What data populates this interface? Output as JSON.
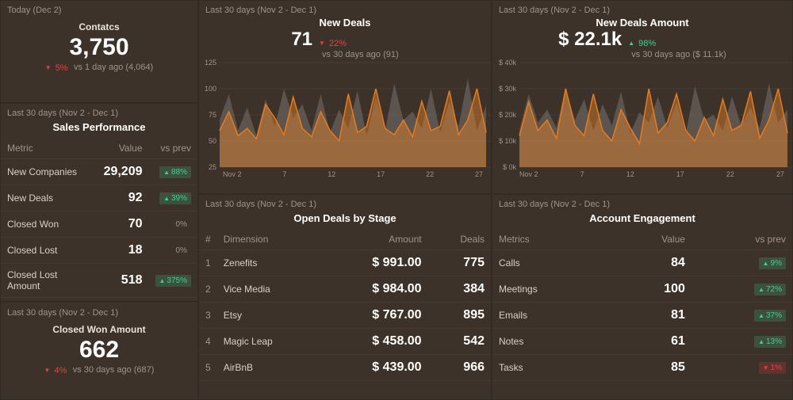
{
  "periods": {
    "today": "Today (Dec 2)",
    "last30": "Last 30 days (Nov 2 - Dec 1)"
  },
  "contacts": {
    "title": "Contatcs",
    "value": "3,750",
    "delta": "5%",
    "delta_dir": "down",
    "context": "vs 1 day ago (4,064)"
  },
  "sales_performance": {
    "title": "Sales Performance",
    "cols": [
      "Metric",
      "Value",
      "vs prev"
    ],
    "rows": [
      {
        "metric": "New Companies",
        "value": "29,209",
        "delta": "88%",
        "dir": "up"
      },
      {
        "metric": "New Deals",
        "value": "92",
        "delta": "39%",
        "dir": "up"
      },
      {
        "metric": "Closed Won",
        "value": "70",
        "delta": "0%",
        "dir": "neutral"
      },
      {
        "metric": "Closed Lost",
        "value": "18",
        "delta": "0%",
        "dir": "neutral"
      },
      {
        "metric": "Closed Lost Amount",
        "value": "518",
        "delta": "375%",
        "dir": "up"
      }
    ]
  },
  "closed_won": {
    "title": "Closed Won Amount",
    "value": "662",
    "delta": "4%",
    "delta_dir": "down",
    "context": "vs 30 days ago (687)"
  },
  "new_deals": {
    "title": "New Deals",
    "value": "71",
    "delta": "22%",
    "delta_dir": "down",
    "context": "vs 30 days ago (91)"
  },
  "new_deals_amount": {
    "title": "New Deals Amount",
    "value": "$ 22.1k",
    "delta": "98%",
    "delta_dir": "up",
    "context": "vs 30 days ago ($ 11.1k)"
  },
  "open_deals": {
    "title": "Open Deals by Stage",
    "cols": [
      "#",
      "Dimension",
      "Amount",
      "Deals"
    ],
    "rows": [
      {
        "n": "1",
        "dim": "Zenefits",
        "amount": "$ 991.00",
        "deals": "775"
      },
      {
        "n": "2",
        "dim": "Vice Media",
        "amount": "$ 984.00",
        "deals": "384"
      },
      {
        "n": "3",
        "dim": "Etsy",
        "amount": "$ 767.00",
        "deals": "895"
      },
      {
        "n": "4",
        "dim": "Magic Leap",
        "amount": "$ 458.00",
        "deals": "542"
      },
      {
        "n": "5",
        "dim": "AirBnB",
        "amount": "$ 439.00",
        "deals": "966"
      }
    ]
  },
  "engagement": {
    "title": "Account Engagement",
    "cols": [
      "Metrics",
      "Value",
      "vs prev"
    ],
    "rows": [
      {
        "metric": "Calls",
        "value": "84",
        "delta": "9%",
        "dir": "up"
      },
      {
        "metric": "Meetings",
        "value": "100",
        "delta": "72%",
        "dir": "up"
      },
      {
        "metric": "Emails",
        "value": "81",
        "delta": "37%",
        "dir": "up"
      },
      {
        "metric": "Notes",
        "value": "61",
        "delta": "13%",
        "dir": "up"
      },
      {
        "metric": "Tasks",
        "value": "85",
        "delta": "1%",
        "dir": "down"
      }
    ]
  },
  "chart_data": [
    {
      "type": "area",
      "title": "New Deals",
      "ylim": [
        25,
        125
      ],
      "yticks": [
        25,
        50,
        75,
        100,
        125
      ],
      "xlabels": [
        "Nov 2",
        "7",
        "12",
        "17",
        "22",
        "27"
      ],
      "series": [
        {
          "name": "previous",
          "values": [
            70,
            95,
            60,
            82,
            55,
            90,
            64,
            100,
            72,
            85,
            60,
            95,
            58,
            80,
            62,
            98,
            55,
            92,
            60,
            105,
            70,
            78,
            62,
            100,
            58,
            88,
            64,
            110,
            60,
            84
          ]
        },
        {
          "name": "current",
          "values": [
            60,
            78,
            55,
            62,
            52,
            85,
            72,
            56,
            92,
            62,
            54,
            78,
            60,
            50,
            95,
            58,
            64,
            100,
            62,
            56,
            70,
            54,
            88,
            60,
            64,
            98,
            56,
            70,
            100,
            58
          ]
        }
      ]
    },
    {
      "type": "area",
      "title": "New Deals Amount",
      "ylim": [
        0,
        40000
      ],
      "yticks": [
        "$ 0k",
        "$ 10k",
        "$ 20k",
        "$ 30k",
        "$ 40k"
      ],
      "xlabels": [
        "Nov 2",
        "7",
        "12",
        "17",
        "22",
        "27"
      ],
      "series": [
        {
          "name": "previous",
          "values": [
            14,
            28,
            17,
            22,
            15,
            30,
            18,
            26,
            14,
            24,
            16,
            29,
            13,
            21,
            17,
            27,
            15,
            25,
            13,
            31,
            18,
            20,
            14,
            27,
            16,
            23,
            15,
            32,
            17,
            22
          ]
        },
        {
          "name": "current",
          "values": [
            12,
            25,
            14,
            18,
            11,
            30,
            16,
            12,
            28,
            14,
            10,
            22,
            15,
            9,
            30,
            13,
            17,
            28,
            14,
            10,
            19,
            12,
            26,
            14,
            16,
            29,
            11,
            18,
            30,
            13
          ]
        }
      ]
    }
  ]
}
